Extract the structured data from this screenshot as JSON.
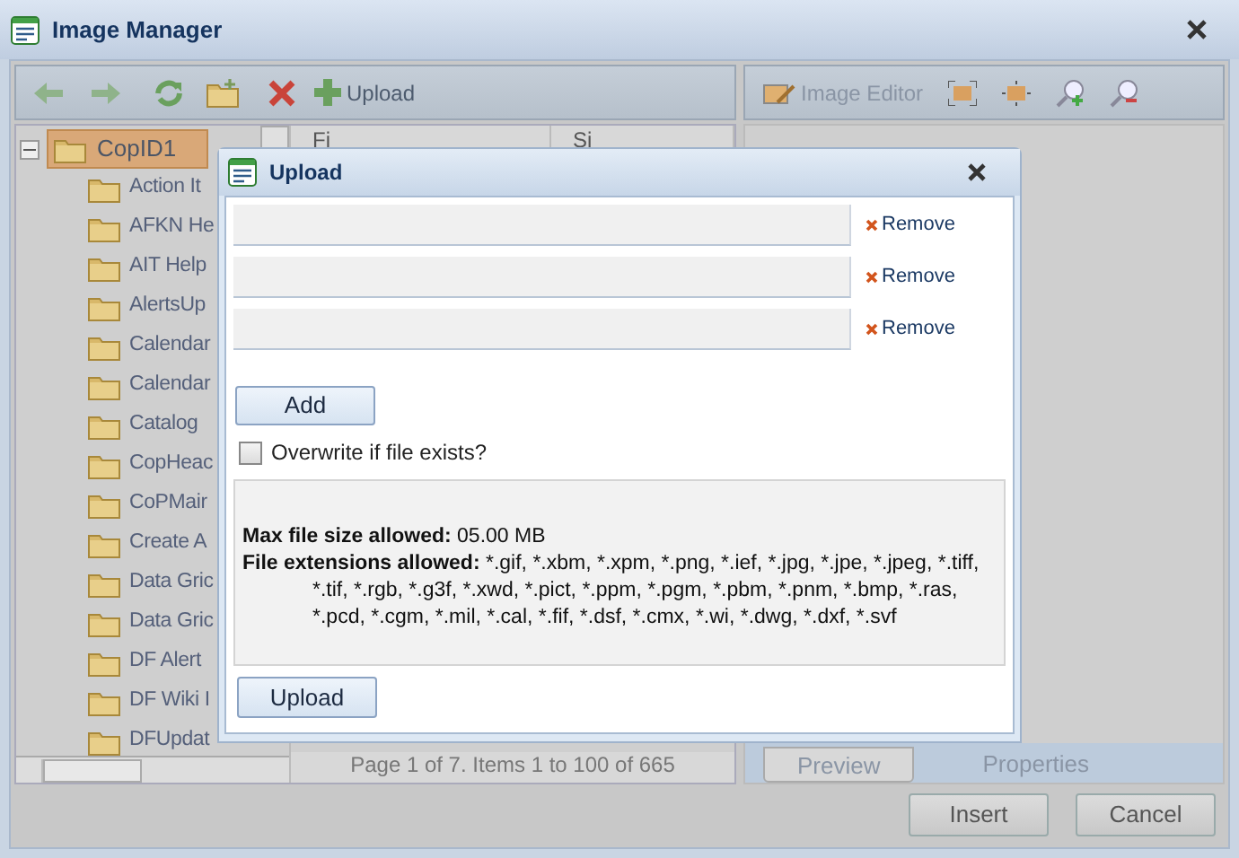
{
  "window": {
    "title": "Image Manager"
  },
  "toolbar": {
    "upload_label": "Upload"
  },
  "viewer_toolbar": {
    "editor_label": "Image Editor"
  },
  "tree": {
    "label": "CopID1",
    "expanded": true,
    "selected": true,
    "children": [
      {
        "label": "Action It",
        "selected": false
      },
      {
        "label": "AFKN He",
        "selected": false
      },
      {
        "label": "AIT Help",
        "selected": false
      },
      {
        "label": "AlertsUp",
        "selected": false
      },
      {
        "label": "Calendar",
        "selected": false
      },
      {
        "label": "Calendar",
        "selected": false
      },
      {
        "label": "Catalog",
        "selected": false
      },
      {
        "label": "CopHeac",
        "selected": false
      },
      {
        "label": "CoPMair",
        "selected": false
      },
      {
        "label": "Create A",
        "selected": false
      },
      {
        "label": "Data Gric",
        "selected": false
      },
      {
        "label": "Data Gric",
        "selected": false
      },
      {
        "label": "DF Alert",
        "selected": false
      },
      {
        "label": "DF Wiki I",
        "selected": false
      },
      {
        "label": "DFUpdat",
        "selected": false
      }
    ]
  },
  "file_list": {
    "columns": [
      "Fi",
      "Si"
    ],
    "pager": "Page 1 of 7. Items 1 to 100 of 665"
  },
  "preview_tabs": [
    {
      "label": "Preview",
      "selected": true
    },
    {
      "label": "Properties",
      "selected": false
    }
  ],
  "buttons": [
    "Insert",
    "Cancel"
  ],
  "upload_dialog": {
    "title": "Upload",
    "file_rows": [
      {
        "remove": "Remove"
      },
      {
        "remove": "Remove"
      },
      {
        "remove": "Remove"
      }
    ],
    "add": "Add",
    "overwrite": {
      "label": "Overwrite if file exists?",
      "checked": false
    },
    "info": [
      {
        "label": "Max file size allowed:",
        "value": "05.00 MB"
      },
      {
        "label": "File extensions allowed:",
        "value": "*.gif, *.xbm, *.xpm, *.png, *.ief, *.jpg, *.jpe, *.jpeg, *.tiff, *.tif, *.rgb, *.g3f, *.xwd, *.pict, *.ppm, *.pgm, *.pbm, *.pnm, *.bmp, *.ras, *.pcd, *.cgm, *.mil, *.cal, *.fif, *.dsf, *.cmx, *.wi, *.dwg, *.dxf, *.svf"
      }
    ],
    "upload": "Upload"
  }
}
